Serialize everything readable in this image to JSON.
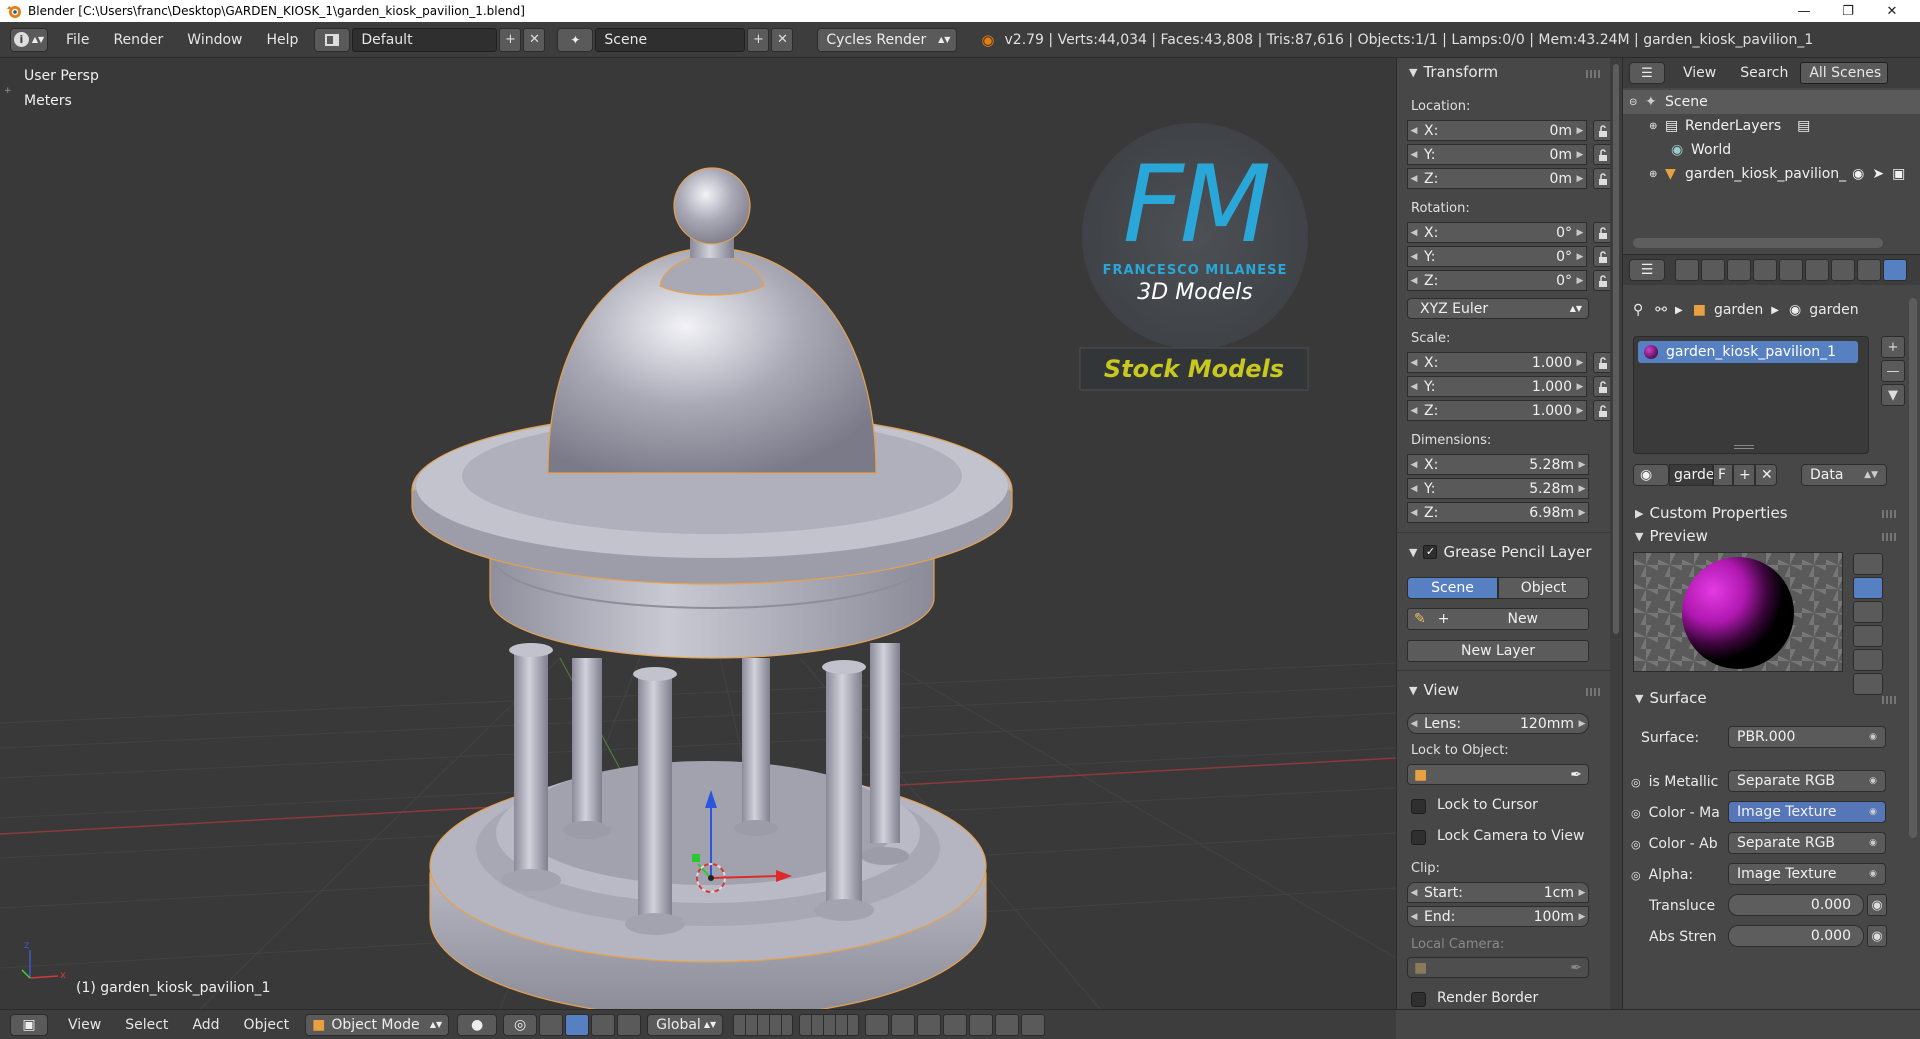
{
  "window": {
    "title": "Blender [C:\\Users\\franc\\Desktop\\GARDEN_KIOSK_1\\garden_kiosk_pavilion_1.blend]"
  },
  "menu": [
    "File",
    "Render",
    "Window",
    "Help"
  ],
  "header": {
    "layout_name": "Default",
    "scene_name": "Scene",
    "engine": "Cycles Render",
    "stats": "v2.79 | Verts:44,034 | Faces:43,808 | Tris:87,616 | Objects:1/1 | Lamps:0/0 | Mem:43.24M | garden_kiosk_pavilion_1"
  },
  "viewport": {
    "view_name": "User Persp",
    "units": "Meters",
    "object_info": "(1) garden_kiosk_pavilion_1",
    "watermark": {
      "initials": "FM",
      "author": "FRANCESCO MILANESE",
      "line": "3D Models",
      "banner": "Stock Models"
    }
  },
  "npanel": {
    "transform": {
      "title": "Transform",
      "location_label": "Location:",
      "location": [
        {
          "axis": "X:",
          "value": "0m"
        },
        {
          "axis": "Y:",
          "value": "0m"
        },
        {
          "axis": "Z:",
          "value": "0m"
        }
      ],
      "rotation_label": "Rotation:",
      "rotation": [
        {
          "axis": "X:",
          "value": "0°"
        },
        {
          "axis": "Y:",
          "value": "0°"
        },
        {
          "axis": "Z:",
          "value": "0°"
        }
      ],
      "rotation_mode": "XYZ Euler",
      "scale_label": "Scale:",
      "scale": [
        {
          "axis": "X:",
          "value": "1.000"
        },
        {
          "axis": "Y:",
          "value": "1.000"
        },
        {
          "axis": "Z:",
          "value": "1.000"
        }
      ],
      "dimensions_label": "Dimensions:",
      "dimensions": [
        {
          "axis": "X:",
          "value": "5.28m"
        },
        {
          "axis": "Y:",
          "value": "5.28m"
        },
        {
          "axis": "Z:",
          "value": "6.98m"
        }
      ]
    },
    "grease_pencil": {
      "title": "Grease Pencil Layer",
      "scene_tab": "Scene",
      "object_tab": "Object",
      "new_label": "New",
      "new_layer_label": "New Layer"
    },
    "view": {
      "title": "View",
      "lens_label": "Lens:",
      "lens_value": "120mm",
      "lock_object_label": "Lock to Object:",
      "lock_cursor": "Lock to Cursor",
      "lock_camera": "Lock Camera to View",
      "clip_label": "Clip:",
      "clip_start_label": "Start:",
      "clip_start": "1cm",
      "clip_end_label": "End:",
      "clip_end": "100m",
      "local_camera_label": "Local Camera:",
      "render_border": "Render Border"
    }
  },
  "outliner": {
    "menu_view": "View",
    "menu_search": "Search",
    "filter": "All Scenes",
    "items": [
      "Scene",
      "RenderLayers",
      "World",
      "garden_kiosk_pavilion_"
    ]
  },
  "properties": {
    "breadcrumb": [
      "garden",
      "garden"
    ],
    "material_slot": "garden_kiosk_pavilion_1",
    "mat_name_short": "garde",
    "fake_user": "F",
    "link_mode": "Data",
    "custom_properties": "Custom Properties",
    "preview": "Preview",
    "surface_title": "Surface",
    "surface_label": "Surface:",
    "surface_value": "PBR.000",
    "inputs": [
      {
        "label": "is Metallic",
        "value": "Separate RGB"
      },
      {
        "label": "Color - Ma",
        "value": "Image Texture"
      },
      {
        "label": "Color - Ab",
        "value": "Separate RGB"
      },
      {
        "label": "Alpha:",
        "value": "Image Texture"
      }
    ],
    "sliders": [
      {
        "label": "Transluce",
        "value": "0.000"
      },
      {
        "label": "Abs Stren",
        "value": "0.000"
      }
    ]
  },
  "bottom": {
    "menu": [
      "View",
      "Select",
      "Add",
      "Object"
    ],
    "mode": "Object Mode",
    "orientation": "Global"
  },
  "colors": {
    "viewport_bg": "#393939",
    "panel_bg": "#474747",
    "accent_blue": "#5680c2",
    "selection_outline": "#e8a04a",
    "watermark_cyan": "#2aa7d9",
    "banner_yellow": "#c8c81e"
  }
}
